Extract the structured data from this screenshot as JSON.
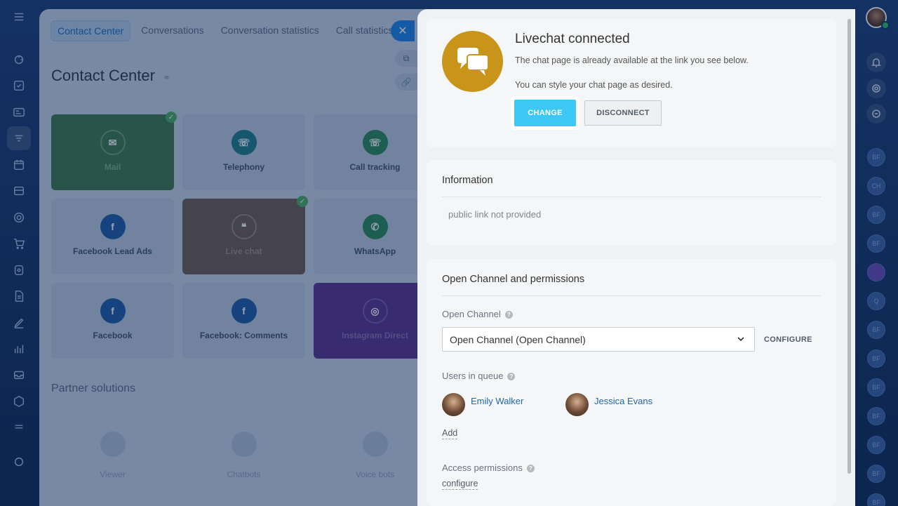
{
  "background": {
    "tabs": [
      "Contact Center",
      "Conversations",
      "Conversation statistics",
      "Call statistics"
    ],
    "title": "Contact Center",
    "tiles": [
      {
        "label": "Mail"
      },
      {
        "label": "Telephony"
      },
      {
        "label": "Call tracking"
      },
      {
        "label": "Facebook Lead Ads"
      },
      {
        "label": "Live chat"
      },
      {
        "label": "WhatsApp"
      },
      {
        "label": "Facebook"
      },
      {
        "label": "Facebook: Comments"
      },
      {
        "label": "Instagram Direct"
      }
    ],
    "partner_title": "Partner solutions",
    "partner_tiles": [
      {
        "label": "Viewer"
      },
      {
        "label": "Chatbots"
      },
      {
        "label": "Voice bots"
      }
    ]
  },
  "right_rail": {
    "avatars": [
      "BF",
      "CH",
      "BF",
      "BF",
      "",
      "Q",
      "BF",
      "BF",
      "BF",
      "BF",
      "BF",
      "BF",
      "BF"
    ]
  },
  "slider": {
    "top": {
      "title": "Livechat connected",
      "desc1": "The chat page is already available at the link you see below.",
      "desc2": "You can style your chat page as desired.",
      "change_label": "CHANGE",
      "disconnect_label": "DISCONNECT"
    },
    "info": {
      "title": "Information",
      "text": "public link not provided"
    },
    "perm": {
      "title": "Open Channel and permissions",
      "open_channel_label": "Open Channel",
      "open_channel_value": "Open Channel (Open Channel)",
      "configure_label": "CONFIGURE",
      "users_label": "Users in queue",
      "users": [
        {
          "name": "Emily Walker"
        },
        {
          "name": "Jessica Evans"
        }
      ],
      "add_label": "Add",
      "access_label": "Access permissions",
      "access_link": "configure"
    }
  },
  "colors": {
    "accent": "#3bc8f5",
    "livechat_icon": "#c8941a",
    "link": "#2067b0"
  }
}
